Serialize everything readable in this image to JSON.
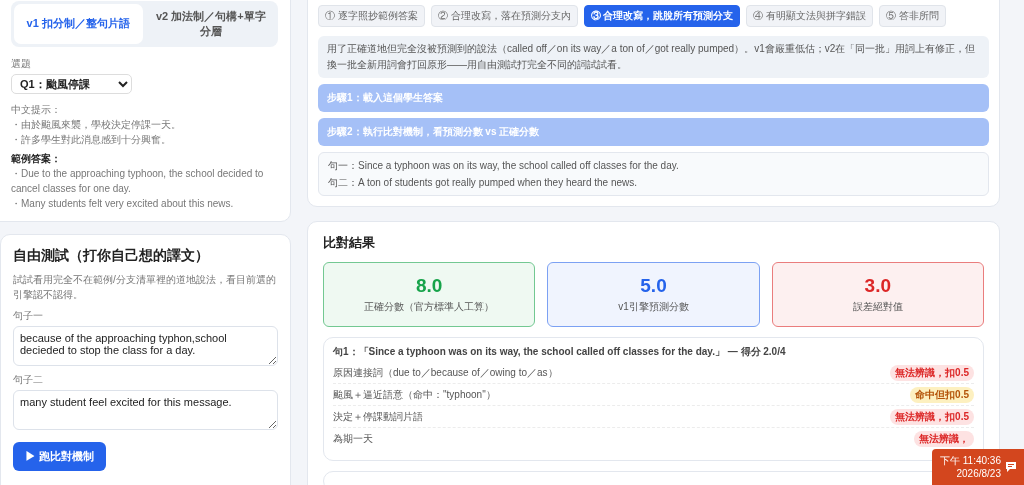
{
  "version_tabs": [
    {
      "label": "v1 扣分制／整句片語",
      "selected": true
    },
    {
      "label": "v2 加法制／句構+單字分層",
      "selected": false
    }
  ],
  "question_select": {
    "label": "選題",
    "value": "Q1：颱風停課"
  },
  "hints": {
    "title": "中文提示：",
    "items": [
      "・由於颱風來襲，學校決定停課一天。",
      "・許多學生對此消息感到十分興奮。"
    ]
  },
  "sample_answer": {
    "title": "範例答案：",
    "items": [
      "・Due to the approaching typhoon, the school decided to cancel classes for one day.",
      "・Many students felt very excited about this news."
    ]
  },
  "free_test": {
    "title": "自由測試（打你自己想的譯文）",
    "description": "試試看用完全不在範例/分支清單裡的道地說法，看目前選的引擎認不認得。",
    "fields": [
      {
        "label": "句子一",
        "value": "because of the approaching typhon,school decieded to stop the class for a day."
      },
      {
        "label": "句子二",
        "value": "many student feel excited for this message."
      }
    ],
    "run_button": "▶ 跑比對機制"
  },
  "scenario_tabs": [
    {
      "label": "① 逐字照抄範例答案",
      "selected": false
    },
    {
      "label": "② 合理改寫，落在預測分支內",
      "selected": false
    },
    {
      "label": "③ 合理改寫，跳脫所有預測分支",
      "selected": true
    },
    {
      "label": "④ 有明顯文法與拼字錯誤",
      "selected": false
    },
    {
      "label": "⑤ 答非所問",
      "selected": false
    }
  ],
  "scenario_description": "用了正確道地但完全沒被預測到的說法（called off／on its way／a ton of／got really pumped）。v1會嚴重低估；v2在「同一批」用詞上有修正，但換一批全新用詞會打回原形——用自由測試打完全不同的詞試試看。",
  "steps": [
    "步驟1：載入這個學生答案",
    "步驟2：執行比對機制，看預測分數 vs 正確分數"
  ],
  "reference_sentences": [
    "句一：Since a typhoon was on its way, the school called off classes for the day.",
    "句二：A ton of students got really pumped when they heard the news."
  ],
  "results": {
    "title": "比對結果",
    "scores": [
      {
        "value": "8.0",
        "label": "正確分數（官方標準人工算）",
        "color": "#16a34a"
      },
      {
        "value": "5.0",
        "label": "v1引擎預測分數",
        "color": "#2563eb"
      },
      {
        "value": "3.0",
        "label": "誤差絕對值",
        "color": "#dc2626"
      }
    ],
    "sentence_detail": {
      "title": "句1：「Since a typhoon was on its way, the school called off classes for the day.」 — 得分 2.0/4",
      "criteria": [
        {
          "label": "原因連接詞（due to／because of／owing to／as）",
          "verdict": "無法辨識，扣0.5",
          "kind": "miss"
        },
        {
          "label": "颱風＋逼近語意（命中：\"typhoon\"）",
          "verdict": "命中但扣0.5",
          "kind": "partial"
        },
        {
          "label": "決定＋停課動詞片語",
          "verdict": "無法辨識，扣0.5",
          "kind": "miss"
        },
        {
          "label": "為期一天",
          "verdict": "無法辨識，",
          "kind": "miss"
        }
      ]
    }
  },
  "clock": {
    "time": "下午 11:40:36",
    "date": "2026/8/23"
  }
}
